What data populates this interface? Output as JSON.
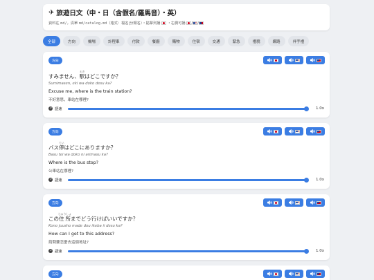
{
  "header": {
    "title": "旅遊日文（中・日（含假名/羅馬音）・英）",
    "subtitle_prefix": "資料在 ",
    "subtitle_code1": "md/",
    "subtitle_mid": "，清單 ",
    "subtitle_code2": "md/catalog.md",
    "subtitle_mid2": "（格式：檔名|分類名）・點擊列播",
    "subtitle_mid3": "・右側可播"
  },
  "chips": [
    {
      "label": "全部",
      "active": true
    },
    {
      "label": "方向",
      "active": false
    },
    {
      "label": "機場",
      "active": false
    },
    {
      "label": "計程車",
      "active": false
    },
    {
      "label": "付款",
      "active": false
    },
    {
      "label": "餐廳",
      "active": false
    },
    {
      "label": "購物",
      "active": false
    },
    {
      "label": "住宿",
      "active": false
    },
    {
      "label": "交通",
      "active": false
    },
    {
      "label": "緊急",
      "active": false
    },
    {
      "label": "禮貌",
      "active": false
    },
    {
      "label": "網路",
      "active": false
    },
    {
      "label": "伴手禮",
      "active": false
    }
  ],
  "speed_label": "語速",
  "cards": [
    {
      "tag": "方向",
      "ja_before": "すみません、",
      "ja_kanji": "駅",
      "ja_ruby": "えき",
      "ja_after": "はどこですか？",
      "romaji": "Sumimasen, eki wa doko desu ka?",
      "en": "Excuse me, where is the train station?",
      "zh": "不好意思，車站在哪裡?",
      "speed": "1.0x"
    },
    {
      "tag": "方向",
      "ja_before": "バス",
      "ja_kanji": "停",
      "ja_ruby": "てい",
      "ja_after": "はどこにありますか？",
      "romaji": "Basu tei wa doko ni arimasu ka?",
      "en": "Where is the bus stop?",
      "zh": "公車站在哪裡?",
      "speed": "1.0x"
    },
    {
      "tag": "方向",
      "ja_before": "この",
      "ja_kanji": "住所",
      "ja_ruby": "じゅうしょ",
      "ja_after": "までどう行けばいいですか？",
      "romaji": "Kono juusho made dou ikeba ii desu ka?",
      "en": "How can I get to this address?",
      "zh": "請問要怎麼去這個地址?",
      "speed": "1.0x"
    },
    {
      "tag": "方向"
    }
  ],
  "colors": {
    "accent": "#3b7de3",
    "background": "#eef0f3"
  }
}
